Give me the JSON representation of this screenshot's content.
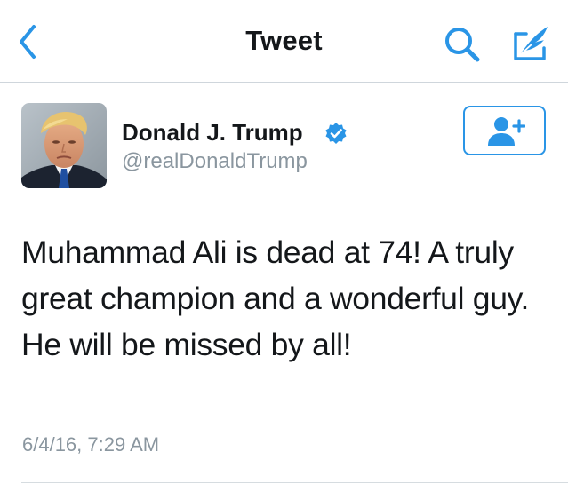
{
  "navbar": {
    "title": "Tweet",
    "back_icon": "chevron-left-icon",
    "search_icon": "search-icon",
    "compose_icon": "compose-icon"
  },
  "tweet": {
    "author_name": "Donald J. Trump",
    "author_handle": "@realDonaldTrump",
    "verified": true,
    "text": "Muhammad Ali is dead at 74! A truly great champion and a wonderful guy. He will be missed by all!",
    "timestamp": "6/4/16, 7:29 AM"
  },
  "follow_button": {
    "icon": "follow-user-icon"
  },
  "colors": {
    "accent": "#2a95e6",
    "text": "#14171a",
    "muted": "#8a969f",
    "divider": "#d6dce0"
  }
}
